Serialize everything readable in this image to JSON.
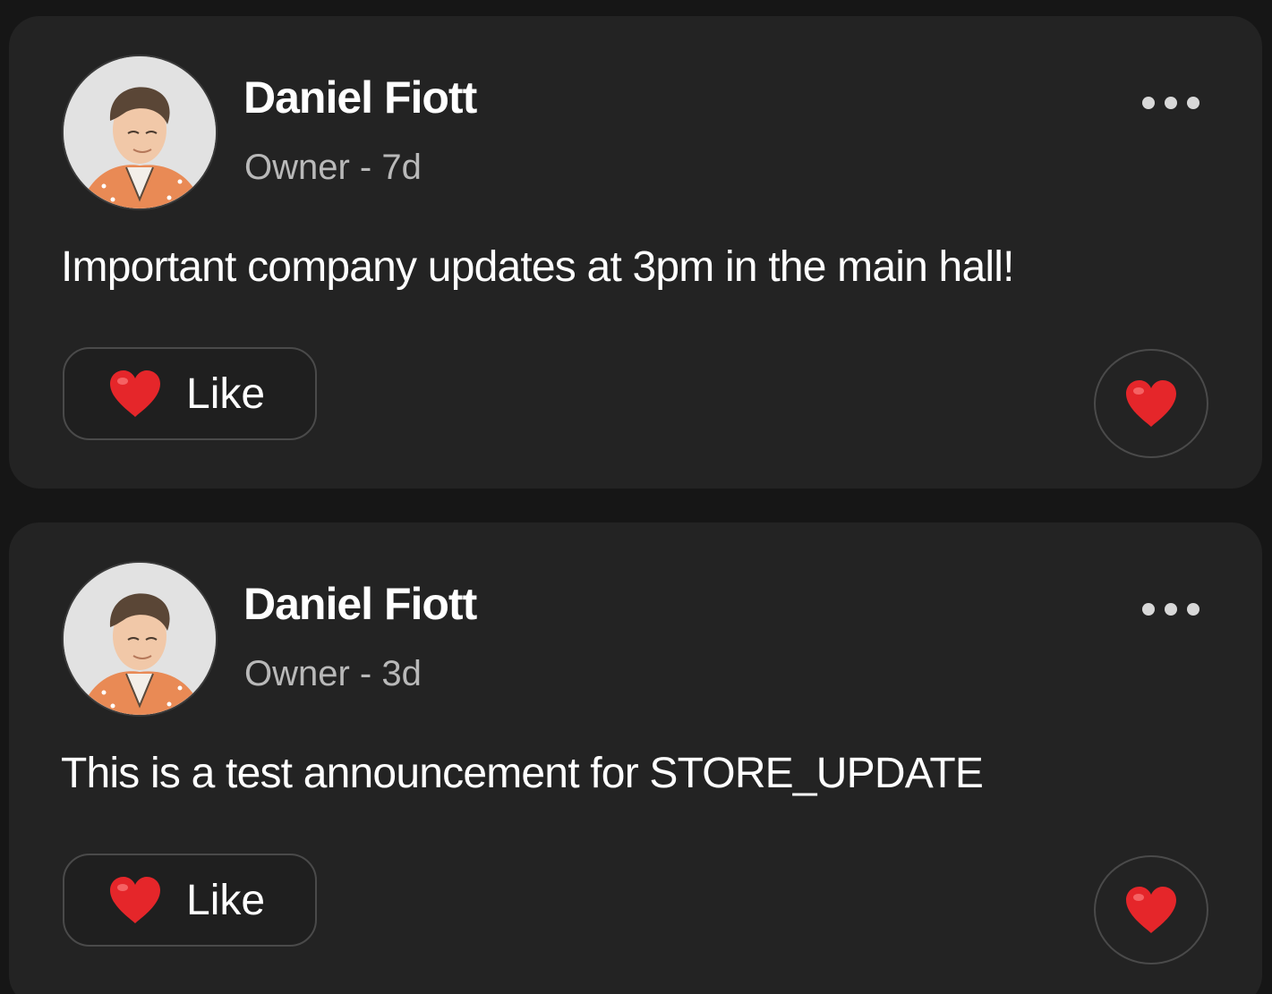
{
  "posts": [
    {
      "author": "Daniel Fiott",
      "meta": "Owner - 7d",
      "body": "Important company updates at 3pm in the main hall!",
      "like_label": "Like"
    },
    {
      "author": "Daniel Fiott",
      "meta": "Owner - 3d",
      "body": "This is a test announcement for STORE_UPDATE",
      "like_label": "Like"
    }
  ],
  "icons": {
    "more": "more-dots-icon",
    "like": "heart-icon",
    "react": "heart-icon"
  },
  "colors": {
    "background": "#161616",
    "card": "#232323",
    "heart": "#e5262a",
    "meta_text": "#b9b9b9"
  }
}
